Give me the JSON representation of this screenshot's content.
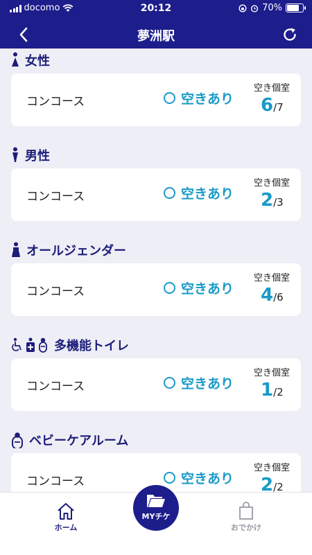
{
  "status": {
    "carrier": "docomo",
    "time": "20:12",
    "battery": "70%",
    "battery_level": 0.7
  },
  "header": {
    "title": "夢洲駅"
  },
  "sections": [
    {
      "title": "女性",
      "icon": "female-icon",
      "location": "コンコース",
      "availability": "空きあり",
      "rooms_label": "空き個室",
      "available": "6",
      "total": "/7"
    },
    {
      "title": "男性",
      "icon": "male-icon",
      "location": "コンコース",
      "availability": "空きあり",
      "rooms_label": "空き個室",
      "available": "2",
      "total": "/3"
    },
    {
      "title": "オールジェンダー",
      "icon": "all-gender-icon",
      "location": "コンコース",
      "availability": "空きあり",
      "rooms_label": "空き個室",
      "available": "4",
      "total": "/6"
    },
    {
      "title": "多機能トイレ",
      "icon": "multipurpose-icons",
      "location": "コンコース",
      "availability": "空きあり",
      "rooms_label": "空き個室",
      "available": "1",
      "total": "/2"
    },
    {
      "title": "ベビーケアルーム",
      "icon": "baby-care-icon",
      "location": "コンコース",
      "availability": "空きあり",
      "rooms_label": "空き個室",
      "available": "2",
      "total": "/2"
    }
  ],
  "tabbar": {
    "home": "ホーム",
    "mychike": "MYチケ",
    "outing": "おでかけ"
  },
  "colors": {
    "navy": "#1d1d8c",
    "accent": "#1a9ac8",
    "background": "#eeeef6"
  }
}
